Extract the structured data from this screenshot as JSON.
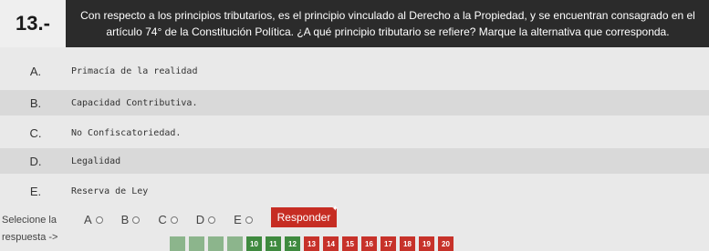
{
  "question": {
    "number": "13.-",
    "line1": "Con respecto a los principios tributarios, es el principio vinculado al Derecho a la Propiedad, y se encuentran consagrado en el",
    "line2": "artículo 74° de la Constitución Política. ¿A qué principio tributario se refiere? Marque la alternativa que corresponda."
  },
  "options": [
    {
      "letter": "A.",
      "text": "Primacía de la realidad"
    },
    {
      "letter": "B.",
      "text": "Capacidad Contributiva."
    },
    {
      "letter": "C.",
      "text": "No Confiscatoriedad."
    },
    {
      "letter": "D.",
      "text": "Legalidad"
    },
    {
      "letter": "E.",
      "text": "Reserva de Ley"
    }
  ],
  "answer": {
    "label_line1": "Selecione la",
    "label_line2": "respuesta ->",
    "choices": [
      "A",
      "B",
      "C",
      "D",
      "E"
    ],
    "button": "Responder"
  },
  "pagination": {
    "visible_pages": [
      "10",
      "11",
      "12",
      "13",
      "14",
      "15",
      "16",
      "17",
      "18",
      "19",
      "20"
    ],
    "current": "13",
    "colors": {
      "green": "#3f8a3f",
      "red": "#c7322a"
    }
  }
}
